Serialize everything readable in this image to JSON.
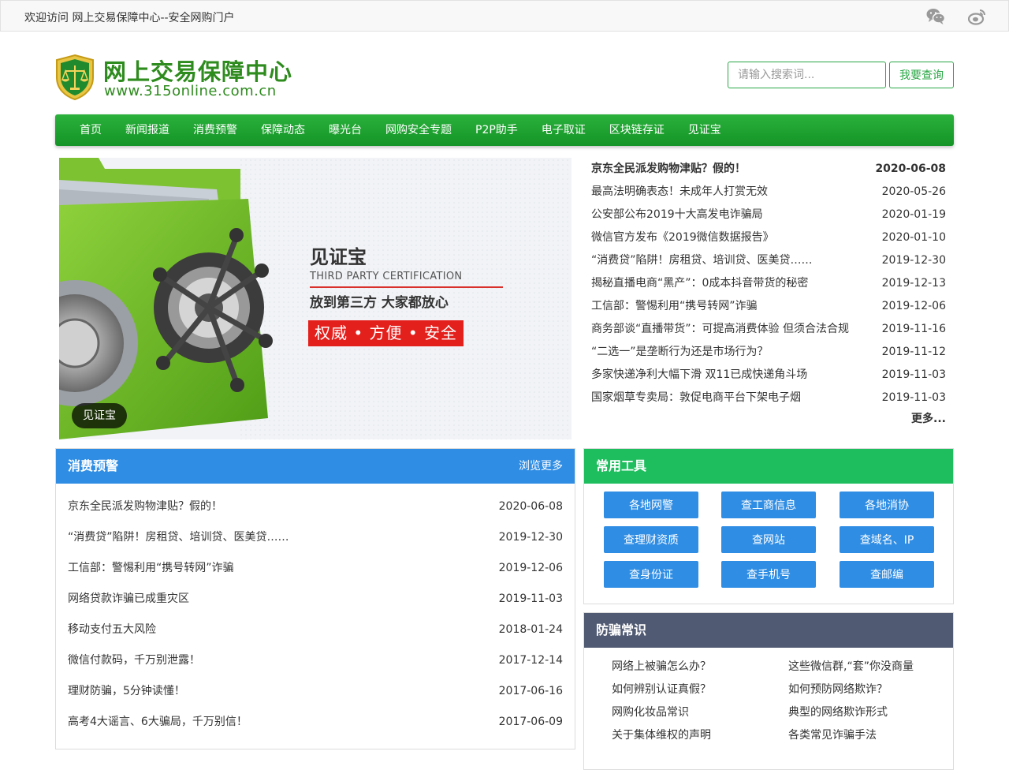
{
  "topbar": {
    "welcome": "欢迎访问 网上交易保障中心--安全网购门户",
    "icons": [
      "wechat-icon",
      "weibo-icon"
    ]
  },
  "logo": {
    "name_cn": "网上交易保障中心",
    "name_en": "www.315online.com.cn"
  },
  "search": {
    "placeholder": "请输入搜索词...",
    "button": "我要查询"
  },
  "nav": [
    "首页",
    "新闻报道",
    "消费预警",
    "保障动态",
    "曝光台",
    "网购安全专题",
    "P2P助手",
    "电子取证",
    "区块链存证",
    "见证宝"
  ],
  "banner": {
    "title": "见证宝",
    "subtitle": "THIRD PARTY CERTIFICATION",
    "slogan": "放到第三方 大家都放心",
    "badge": "权威 • 方便 • 安全",
    "caption": "见证宝"
  },
  "news": {
    "items": [
      {
        "title": "京东全民派发购物津贴？假的！",
        "date": "2020-06-08"
      },
      {
        "title": "最高法明确表态！未成年人打赏无效",
        "date": "2020-05-26"
      },
      {
        "title": "公安部公布2019十大高发电诈骗局",
        "date": "2020-01-19"
      },
      {
        "title": "微信官方发布《2019微信数据报告》",
        "date": "2020-01-10"
      },
      {
        "title": "“消费贷”陷阱！房租贷、培训贷、医美贷……",
        "date": "2019-12-30"
      },
      {
        "title": "揭秘直播电商“黑产”：0成本抖音带货的秘密",
        "date": "2019-12-13"
      },
      {
        "title": "工信部：警惕利用“携号转网”诈骗",
        "date": "2019-12-06"
      },
      {
        "title": "商务部谈“直播带货”：可提高消费体验 但须合法合规",
        "date": "2019-11-16"
      },
      {
        "title": "“二选一”是垄断行为还是市场行为？",
        "date": "2019-11-12"
      },
      {
        "title": "多家快递净利大幅下滑 双11已成快递角斗场",
        "date": "2019-11-03"
      },
      {
        "title": "国家烟草专卖局：敦促电商平台下架电子烟",
        "date": "2019-11-03"
      }
    ],
    "more": "更多..."
  },
  "alerts": {
    "title": "消费预警",
    "more": "浏览更多",
    "items": [
      {
        "title": "京东全民派发购物津贴？假的！",
        "date": "2020-06-08"
      },
      {
        "title": "“消费贷”陷阱！房租贷、培训贷、医美贷……",
        "date": "2019-12-30"
      },
      {
        "title": "工信部：警惕利用“携号转网”诈骗",
        "date": "2019-12-06"
      },
      {
        "title": "网络贷款诈骗已成重灾区",
        "date": "2019-11-03"
      },
      {
        "title": "移动支付五大风险",
        "date": "2018-01-24"
      },
      {
        "title": "微信付款码，千万别泄露！",
        "date": "2017-12-14"
      },
      {
        "title": "理财防骗，5分钟读懂！",
        "date": "2017-06-16"
      },
      {
        "title": "高考4大谣言、6大骗局，千万别信！",
        "date": "2017-06-09"
      }
    ]
  },
  "tools": {
    "title": "常用工具",
    "items": [
      "各地网警",
      "查工商信息",
      "各地消协",
      "查理财资质",
      "查网站",
      "查域名、IP",
      "查身份证",
      "查手机号",
      "查邮编"
    ]
  },
  "fraud": {
    "title": "防骗常识",
    "items": [
      "网络上被骗怎么办？",
      "这些微信群,“套”你没商量",
      "如何辨别认证真假？",
      "如何预防网络欺诈？",
      "网购化妆品常识",
      "典型的网络欺诈形式",
      "关于集体维权的声明",
      "各类常见诈骗手法"
    ]
  }
}
